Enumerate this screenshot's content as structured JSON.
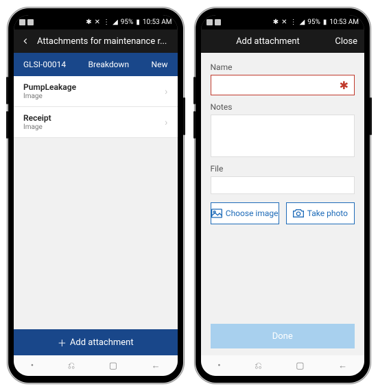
{
  "statusbar": {
    "battery": "95%",
    "time": "10:53 AM"
  },
  "left": {
    "header_title": "Attachments for maintenance r...",
    "info": {
      "id": "GLSI-00014",
      "type": "Breakdown",
      "status": "New"
    },
    "items": [
      {
        "title": "PumpLeakage",
        "subtitle": "Image"
      },
      {
        "title": "Receipt",
        "subtitle": "Image"
      }
    ],
    "add_button": "Add attachment"
  },
  "right": {
    "header_title": "Add attachment",
    "close_label": "Close",
    "labels": {
      "name": "Name",
      "notes": "Notes",
      "file": "File"
    },
    "buttons": {
      "choose": "Choose image",
      "photo": "Take photo",
      "done": "Done"
    },
    "values": {
      "name": "",
      "notes": "",
      "file": ""
    }
  },
  "softkeys": {
    "dot": "•",
    "recents": "⎌",
    "home": "▢",
    "back": "←"
  }
}
